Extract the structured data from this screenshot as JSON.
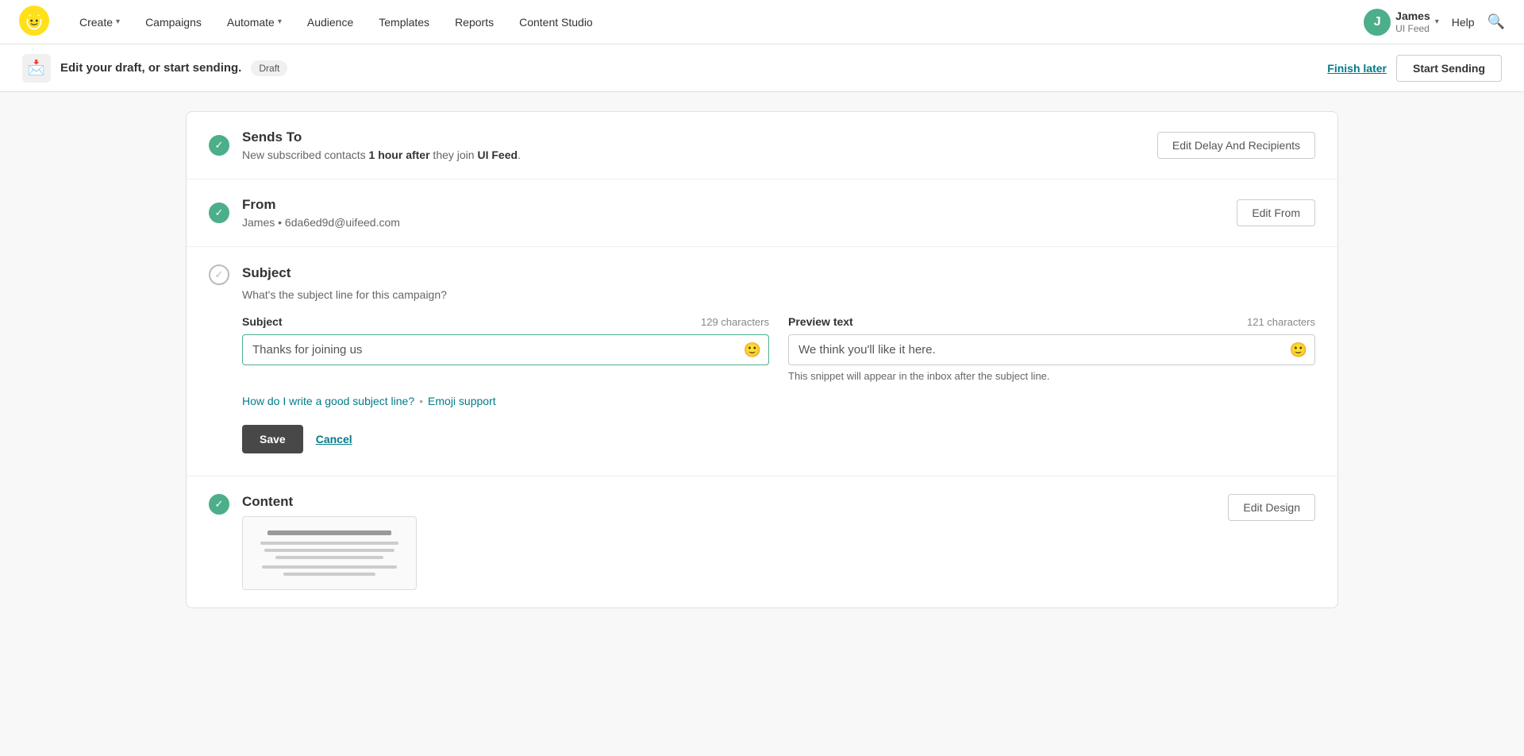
{
  "nav": {
    "logo_alt": "Mailchimp logo",
    "items": [
      {
        "id": "create",
        "label": "Create",
        "has_chevron": true
      },
      {
        "id": "campaigns",
        "label": "Campaigns",
        "has_chevron": false
      },
      {
        "id": "automate",
        "label": "Automate",
        "has_chevron": true
      },
      {
        "id": "audience",
        "label": "Audience",
        "has_chevron": false
      },
      {
        "id": "templates",
        "label": "Templates",
        "has_chevron": false
      },
      {
        "id": "reports",
        "label": "Reports",
        "has_chevron": false
      },
      {
        "id": "content_studio",
        "label": "Content Studio",
        "has_chevron": false
      }
    ],
    "user": {
      "initial": "J",
      "name": "James",
      "sub": "UI Feed",
      "chevron": "▾"
    },
    "help_label": "Help"
  },
  "draft_bar": {
    "title": "Edit your draft, or start sending.",
    "badge": "Draft",
    "finish_later": "Finish later",
    "start_sending": "Start Sending"
  },
  "sections": {
    "sends_to": {
      "title": "Sends To",
      "subtitle_pre": "New subscribed contacts ",
      "subtitle_bold": "1 hour after",
      "subtitle_post": " they join ",
      "subtitle_brand": "UI Feed",
      "subtitle_period": ".",
      "edit_btn": "Edit Delay And Recipients",
      "completed": true
    },
    "from": {
      "title": "From",
      "name": "James",
      "separator": "•",
      "email": "6da6ed9d@uifeed.com",
      "edit_btn": "Edit From",
      "completed": true
    },
    "subject": {
      "title": "Subject",
      "description": "What's the subject line for this campaign?",
      "completed": false,
      "subject_label": "Subject",
      "subject_char_count": "129 characters",
      "subject_value": "Thanks for joining us",
      "preview_label": "Preview text",
      "preview_char_count": "121 characters",
      "preview_value": "We think you'll like it here.",
      "preview_hint": "This snippet will appear in the inbox after the subject line.",
      "link_1": "How do I write a good subject line?",
      "dot_sep": "•",
      "link_2": "Emoji support",
      "save_btn": "Save",
      "cancel_btn": "Cancel"
    },
    "content": {
      "title": "Content",
      "edit_btn": "Edit Design",
      "completed": true
    }
  }
}
